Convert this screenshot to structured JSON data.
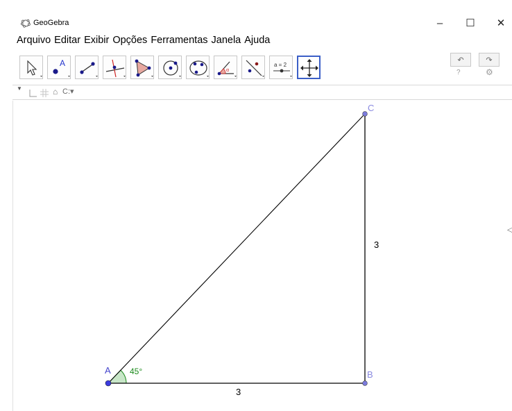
{
  "window": {
    "title": "GeoGebra",
    "minimize_glyph": "–",
    "maximize_glyph": "☐",
    "close_glyph": "✕"
  },
  "menu": {
    "items": [
      "Arquivo",
      "Editar",
      "Exibir",
      "Opções",
      "Ferramentas",
      "Janela",
      "Ajuda"
    ]
  },
  "toolbar": {
    "tools": [
      {
        "icon": "move-arrow-icon"
      },
      {
        "icon": "point-icon",
        "label": "A"
      },
      {
        "icon": "line-through-points-icon"
      },
      {
        "icon": "perpendicular-line-icon"
      },
      {
        "icon": "polygon-icon"
      },
      {
        "icon": "circle-center-point-icon"
      },
      {
        "icon": "conic-through-points-icon"
      },
      {
        "icon": "angle-icon"
      },
      {
        "icon": "reflect-about-line-icon"
      },
      {
        "icon": "slider-icon",
        "label": "a = 2"
      },
      {
        "icon": "move-graphics-view-icon",
        "active": true
      }
    ],
    "undo_glyph": "↶",
    "redo_glyph": "↷",
    "help_glyph": "?",
    "settings_glyph": "⚙"
  },
  "stylebar": {
    "toggle_glyph": "▼",
    "home_glyph": "⌂",
    "color_glyph": "C:▾"
  },
  "construction": {
    "points": [
      {
        "name": "A",
        "color": "#3b3be0"
      },
      {
        "name": "B",
        "color": "#7b7bdd"
      },
      {
        "name": "C",
        "color": "#7b7bdd"
      }
    ],
    "segments": [
      {
        "from": "A",
        "to": "B",
        "label": "3"
      },
      {
        "from": "B",
        "to": "C",
        "label": "3"
      },
      {
        "from": "A",
        "to": "C"
      }
    ],
    "angle": {
      "vertex": "A",
      "label": "45°",
      "color": "#1b8a1b"
    },
    "colors": {
      "segment": "#000000",
      "point_label": "#6666dd",
      "angle_fill": "#c8e6c8"
    }
  }
}
